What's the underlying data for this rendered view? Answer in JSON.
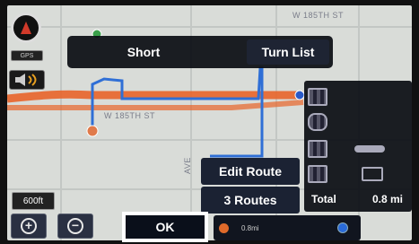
{
  "topbar": {
    "short_label": "Short",
    "turn_list_label": "Turn List"
  },
  "left": {
    "gps_badge": "GPS",
    "scale_label": "600ft",
    "zoom_in_symbol": "+",
    "zoom_out_symbol": "−"
  },
  "map": {
    "street_top": "W 185TH ST",
    "street_mid": "W 185TH ST",
    "street_vertical": "AVE"
  },
  "right_panel": {
    "total_label": "Total",
    "total_value": "0.8 mi"
  },
  "buttons": {
    "edit_route_label": "Edit Route",
    "routes_label": "3 Routes",
    "ok_label": "OK"
  },
  "bottom_info": {
    "distance_text": "0.8mi"
  },
  "colors": {
    "route_orange": "#e8642a",
    "route_blue": "#2f6fd6",
    "panel_dark": "#0a0c12",
    "button_bg": "#1b2233"
  },
  "icons": {
    "compass": "compass-icon",
    "speaker": "speaker-icon",
    "zoom_in": "zoom-in-icon",
    "zoom_out": "zoom-out-icon",
    "lane": "lane-icon",
    "start": "start-marker-icon",
    "destination": "destination-marker-icon"
  }
}
